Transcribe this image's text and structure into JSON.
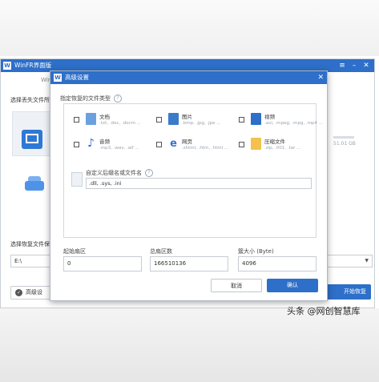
{
  "main_window": {
    "title": "WinFR界面版",
    "subtab": "WinFr",
    "section_location": "选择丢失文件所在",
    "section_save": "选择恢复文件保存",
    "save_path": "E:\\",
    "drive_size": "51.01 GB",
    "advanced_button": "高级设",
    "start_button": "开始恢复"
  },
  "dialog": {
    "title": "高级设置",
    "section_types": "指定恢复的文件类型",
    "file_types": [
      {
        "name": "文档",
        "exts": ".txt, .doc, .docm ...",
        "icon": "document-icon",
        "color": "#6aa0e0",
        "checked": false
      },
      {
        "name": "图片",
        "exts": ".bmp, .jpg, .jpe ...",
        "icon": "image-icon",
        "color": "#3a7cc9",
        "checked": false
      },
      {
        "name": "视频",
        "exts": ".avi, .mpeg, .mpg, .mp4 ...",
        "icon": "video-icon",
        "color": "#2d6fc9",
        "checked": false
      },
      {
        "name": "音频",
        "exts": ".mp3, .wav, .aif ...",
        "icon": "music-note-icon",
        "color": "#2d6fc9",
        "checked": false
      },
      {
        "name": "网页",
        "exts": ".shtml, .htm, .html ...",
        "icon": "edge-browser-icon",
        "color": "#2f78d4",
        "checked": false
      },
      {
        "name": "压缩文件",
        "exts": ".zip, .001, .tar ...",
        "icon": "archive-icon",
        "color": "#f2c14e",
        "checked": false
      }
    ],
    "custom": {
      "label": "自定义后缀名或文件名",
      "value": ".dll, .sys, .ini",
      "checked": true
    },
    "fields": {
      "start_sector_label": "起始扇区",
      "start_sector_value": "0",
      "total_sectors_label": "总扇区数",
      "total_sectors_value": "166510136",
      "cluster_size_label": "簇大小 (Byte)",
      "cluster_size_value": "4096"
    },
    "cancel_button": "取消",
    "ok_button": "确认"
  },
  "watermark": "头条 @网创智慧库"
}
